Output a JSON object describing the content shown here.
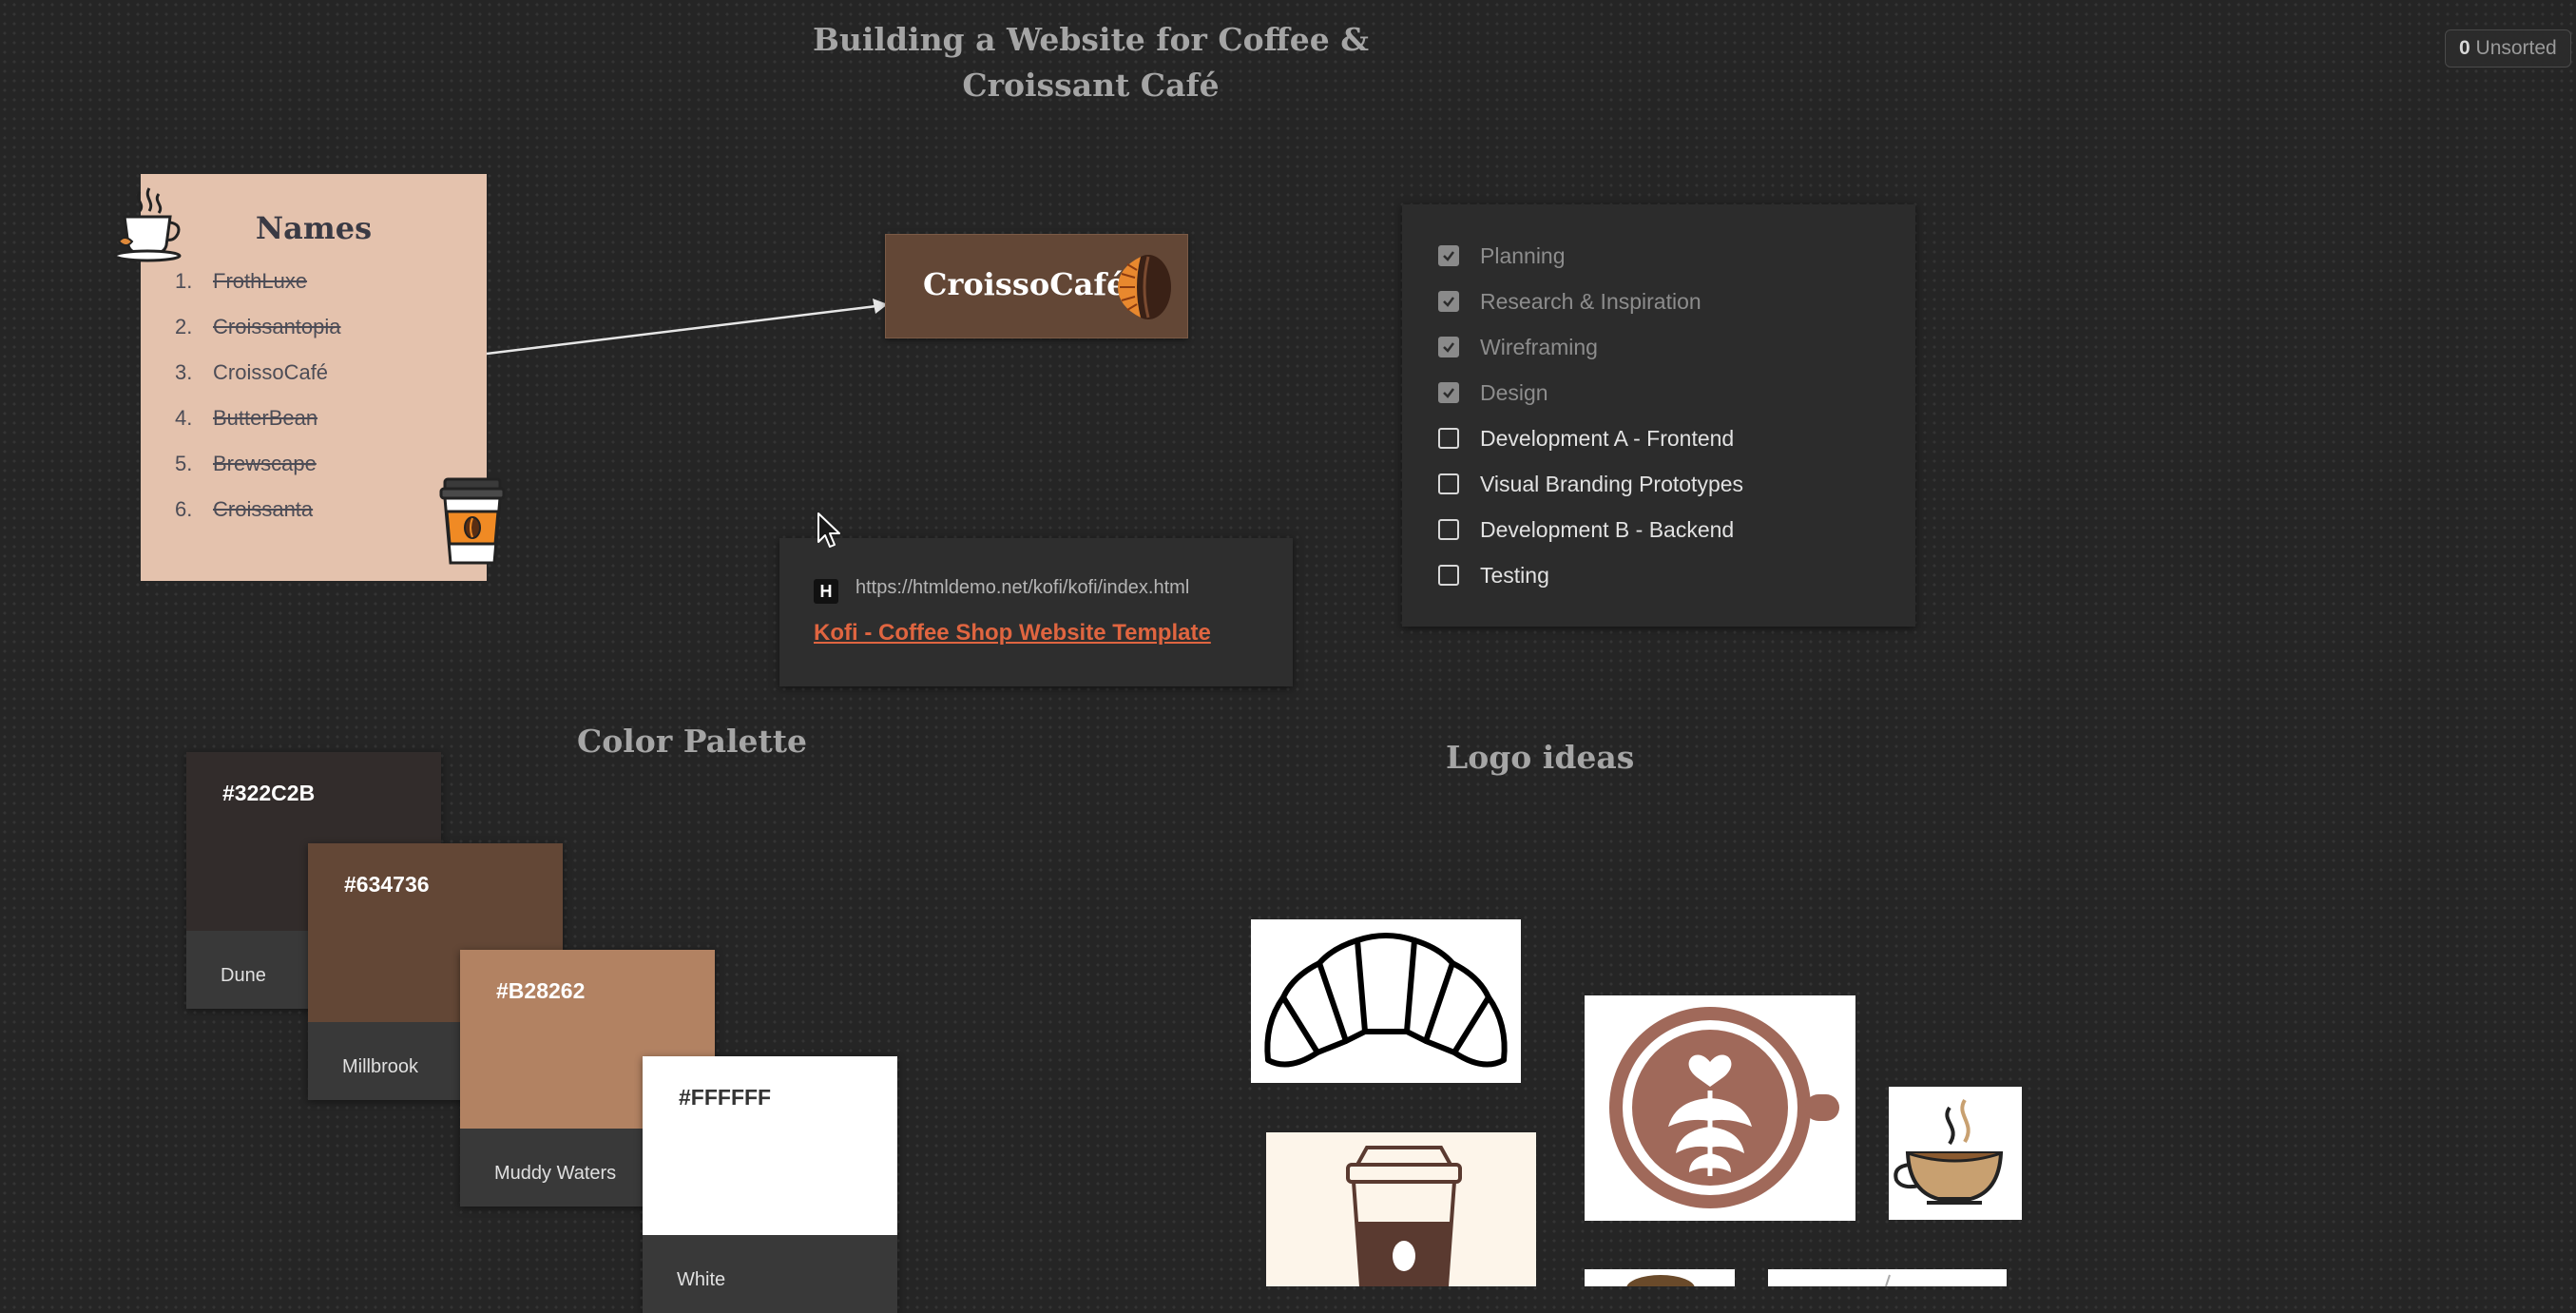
{
  "board": {
    "title": "Building a Website for Coffee & Croissant Café",
    "unsorted_count": "0",
    "unsorted_label": "Unsorted"
  },
  "names": {
    "title": "Names",
    "items": [
      {
        "num": "1.",
        "name": "FrothLuxe",
        "struck": true
      },
      {
        "num": "2.",
        "name": "Croissantopia",
        "struck": true
      },
      {
        "num": "3.",
        "name": "CroissoCafé",
        "struck": false
      },
      {
        "num": "4.",
        "name": "ButterBean",
        "struck": true
      },
      {
        "num": "5.",
        "name": "Brewscape",
        "struck": true
      },
      {
        "num": "6.",
        "name": "Croissanta",
        "struck": true
      }
    ]
  },
  "logo_tile": {
    "text": "CroissoCafé"
  },
  "link_card": {
    "favicon": "H",
    "url": "https://htmldemo.net/kofi/kofi/index.html",
    "title": "Kofi - Coffee Shop Website Template"
  },
  "checklist": {
    "items": [
      {
        "label": "Planning",
        "checked": true
      },
      {
        "label": "Research & Inspiration",
        "checked": true
      },
      {
        "label": "Wireframing",
        "checked": true
      },
      {
        "label": "Design",
        "checked": true
      },
      {
        "label": "Development A - Frontend",
        "checked": false
      },
      {
        "label": "Visual Branding Prototypes",
        "checked": false
      },
      {
        "label": "Development B - Backend",
        "checked": false
      },
      {
        "label": "Testing",
        "checked": false
      }
    ]
  },
  "palette": {
    "title": "Color Palette",
    "swatches": [
      {
        "hex": "#322C2B",
        "name": "Dune",
        "color": "#322C2B",
        "text_color": "#ffffff"
      },
      {
        "hex": "#634736",
        "name": "Millbrook",
        "color": "#634736",
        "text_color": "#ffffff"
      },
      {
        "hex": "#B28262",
        "name": "Muddy Waters",
        "color": "#B28262",
        "text_color": "#ffffff"
      },
      {
        "hex": "#FFFFFF",
        "name": "White",
        "color": "#FFFFFF",
        "text_color": "#333333"
      }
    ]
  },
  "logo_ideas": {
    "title": "Logo ideas",
    "images": [
      "croissant-outline-icon",
      "latte-art-cup-icon",
      "steaming-coffee-cup-icon",
      "takeaway-cup-icon",
      "coffee-partial-icon",
      "logo-partial-icon"
    ]
  },
  "colors": {
    "background": "#252525",
    "names_card": "#e4c2ad",
    "accent_link": "#e06540"
  }
}
